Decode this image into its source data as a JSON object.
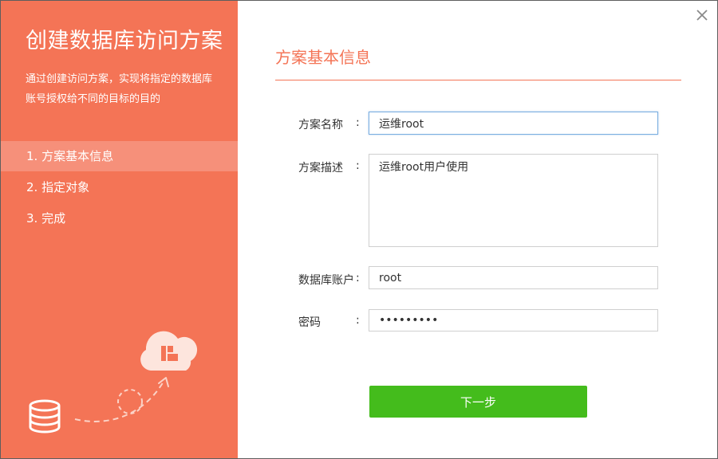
{
  "sidebar": {
    "title": "创建数据库访问方案",
    "description": "通过创建访问方案，实现将指定的数据库账号授权给不同的目标的目的",
    "steps": [
      {
        "label": "1. 方案基本信息",
        "active": true
      },
      {
        "label": "2. 指定对象",
        "active": false
      },
      {
        "label": "3. 完成",
        "active": false
      }
    ],
    "illustration_icons": [
      "database-icon",
      "cloud-icon",
      "dashed-arrow-icon"
    ]
  },
  "dialog": {
    "close_icon": "close-icon"
  },
  "form": {
    "section_title": "方案基本信息",
    "colon": ":",
    "fields": {
      "name": {
        "label": "方案名称",
        "value": "运维root"
      },
      "description": {
        "label": "方案描述",
        "value": "运维root用户使用"
      },
      "db_account": {
        "label": "数据库账户",
        "value": "root"
      },
      "password": {
        "label": "密码",
        "value": "rootroots"
      }
    },
    "next_button": "下一步"
  },
  "colors": {
    "accent": "#f47456",
    "sidebar_active": "#f6907a",
    "button": "#44bc1c"
  }
}
